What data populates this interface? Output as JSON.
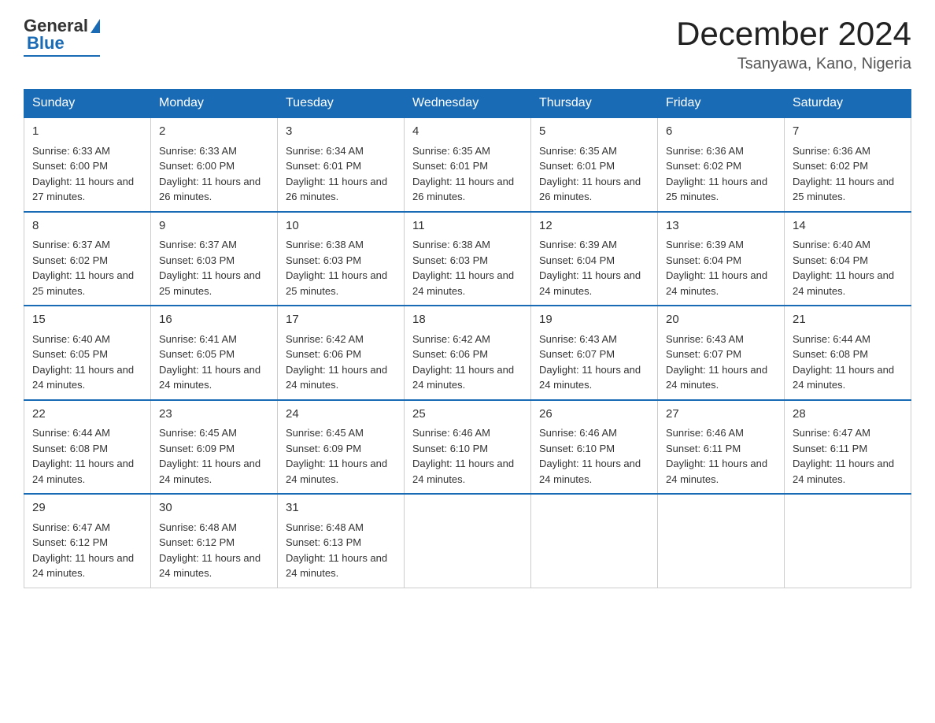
{
  "header": {
    "logo_general": "General",
    "logo_blue": "Blue",
    "month_year": "December 2024",
    "location": "Tsanyawa, Kano, Nigeria"
  },
  "weekdays": [
    "Sunday",
    "Monday",
    "Tuesday",
    "Wednesday",
    "Thursday",
    "Friday",
    "Saturday"
  ],
  "weeks": [
    [
      {
        "day": "1",
        "sunrise": "6:33 AM",
        "sunset": "6:00 PM",
        "daylight": "11 hours and 27 minutes."
      },
      {
        "day": "2",
        "sunrise": "6:33 AM",
        "sunset": "6:00 PM",
        "daylight": "11 hours and 26 minutes."
      },
      {
        "day": "3",
        "sunrise": "6:34 AM",
        "sunset": "6:01 PM",
        "daylight": "11 hours and 26 minutes."
      },
      {
        "day": "4",
        "sunrise": "6:35 AM",
        "sunset": "6:01 PM",
        "daylight": "11 hours and 26 minutes."
      },
      {
        "day": "5",
        "sunrise": "6:35 AM",
        "sunset": "6:01 PM",
        "daylight": "11 hours and 26 minutes."
      },
      {
        "day": "6",
        "sunrise": "6:36 AM",
        "sunset": "6:02 PM",
        "daylight": "11 hours and 25 minutes."
      },
      {
        "day": "7",
        "sunrise": "6:36 AM",
        "sunset": "6:02 PM",
        "daylight": "11 hours and 25 minutes."
      }
    ],
    [
      {
        "day": "8",
        "sunrise": "6:37 AM",
        "sunset": "6:02 PM",
        "daylight": "11 hours and 25 minutes."
      },
      {
        "day": "9",
        "sunrise": "6:37 AM",
        "sunset": "6:03 PM",
        "daylight": "11 hours and 25 minutes."
      },
      {
        "day": "10",
        "sunrise": "6:38 AM",
        "sunset": "6:03 PM",
        "daylight": "11 hours and 25 minutes."
      },
      {
        "day": "11",
        "sunrise": "6:38 AM",
        "sunset": "6:03 PM",
        "daylight": "11 hours and 24 minutes."
      },
      {
        "day": "12",
        "sunrise": "6:39 AM",
        "sunset": "6:04 PM",
        "daylight": "11 hours and 24 minutes."
      },
      {
        "day": "13",
        "sunrise": "6:39 AM",
        "sunset": "6:04 PM",
        "daylight": "11 hours and 24 minutes."
      },
      {
        "day": "14",
        "sunrise": "6:40 AM",
        "sunset": "6:04 PM",
        "daylight": "11 hours and 24 minutes."
      }
    ],
    [
      {
        "day": "15",
        "sunrise": "6:40 AM",
        "sunset": "6:05 PM",
        "daylight": "11 hours and 24 minutes."
      },
      {
        "day": "16",
        "sunrise": "6:41 AM",
        "sunset": "6:05 PM",
        "daylight": "11 hours and 24 minutes."
      },
      {
        "day": "17",
        "sunrise": "6:42 AM",
        "sunset": "6:06 PM",
        "daylight": "11 hours and 24 minutes."
      },
      {
        "day": "18",
        "sunrise": "6:42 AM",
        "sunset": "6:06 PM",
        "daylight": "11 hours and 24 minutes."
      },
      {
        "day": "19",
        "sunrise": "6:43 AM",
        "sunset": "6:07 PM",
        "daylight": "11 hours and 24 minutes."
      },
      {
        "day": "20",
        "sunrise": "6:43 AM",
        "sunset": "6:07 PM",
        "daylight": "11 hours and 24 minutes."
      },
      {
        "day": "21",
        "sunrise": "6:44 AM",
        "sunset": "6:08 PM",
        "daylight": "11 hours and 24 minutes."
      }
    ],
    [
      {
        "day": "22",
        "sunrise": "6:44 AM",
        "sunset": "6:08 PM",
        "daylight": "11 hours and 24 minutes."
      },
      {
        "day": "23",
        "sunrise": "6:45 AM",
        "sunset": "6:09 PM",
        "daylight": "11 hours and 24 minutes."
      },
      {
        "day": "24",
        "sunrise": "6:45 AM",
        "sunset": "6:09 PM",
        "daylight": "11 hours and 24 minutes."
      },
      {
        "day": "25",
        "sunrise": "6:46 AM",
        "sunset": "6:10 PM",
        "daylight": "11 hours and 24 minutes."
      },
      {
        "day": "26",
        "sunrise": "6:46 AM",
        "sunset": "6:10 PM",
        "daylight": "11 hours and 24 minutes."
      },
      {
        "day": "27",
        "sunrise": "6:46 AM",
        "sunset": "6:11 PM",
        "daylight": "11 hours and 24 minutes."
      },
      {
        "day": "28",
        "sunrise": "6:47 AM",
        "sunset": "6:11 PM",
        "daylight": "11 hours and 24 minutes."
      }
    ],
    [
      {
        "day": "29",
        "sunrise": "6:47 AM",
        "sunset": "6:12 PM",
        "daylight": "11 hours and 24 minutes."
      },
      {
        "day": "30",
        "sunrise": "6:48 AM",
        "sunset": "6:12 PM",
        "daylight": "11 hours and 24 minutes."
      },
      {
        "day": "31",
        "sunrise": "6:48 AM",
        "sunset": "6:13 PM",
        "daylight": "11 hours and 24 minutes."
      },
      null,
      null,
      null,
      null
    ]
  ],
  "sunrise_label": "Sunrise:",
  "sunset_label": "Sunset:",
  "daylight_label": "Daylight:"
}
